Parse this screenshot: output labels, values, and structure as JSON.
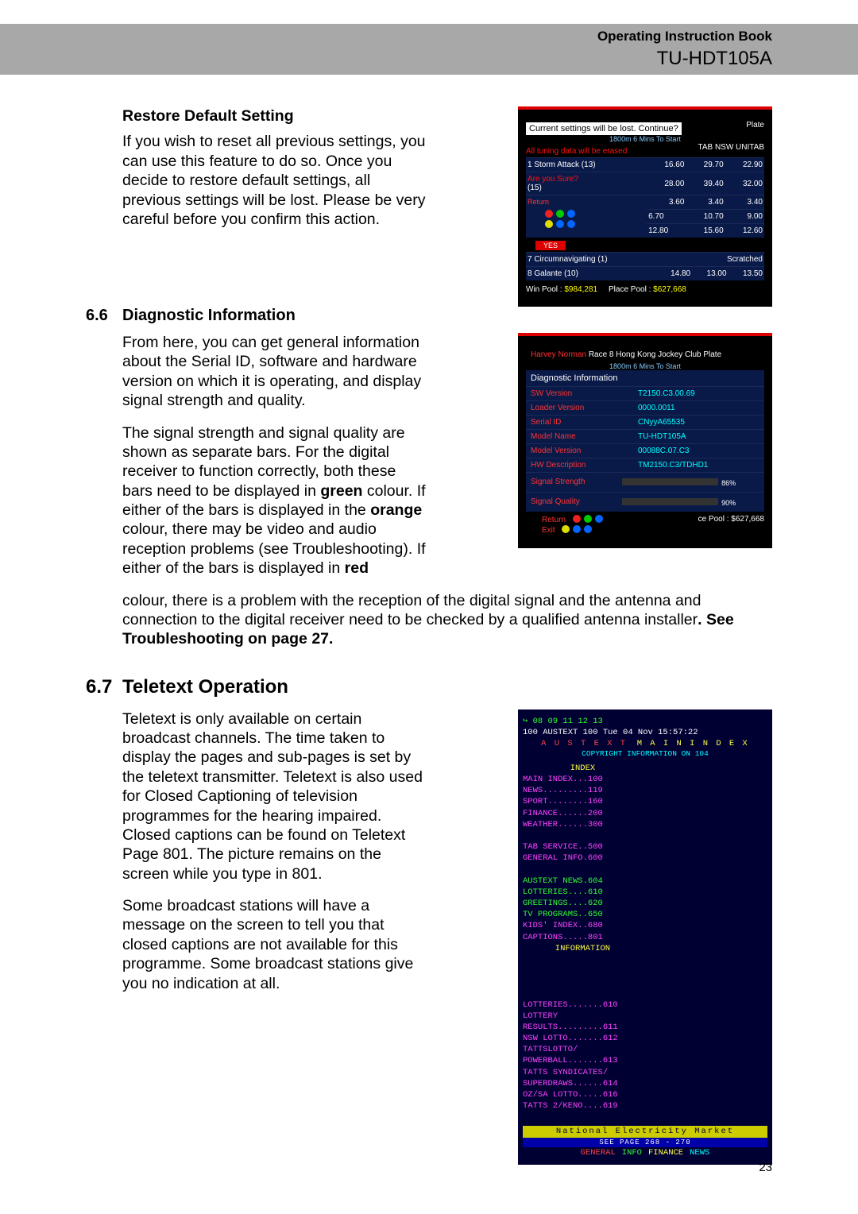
{
  "header": {
    "book_title": "Operating Instruction Book",
    "model_no": "TU-HDT105A"
  },
  "restore": {
    "title": "Restore Default Setting",
    "body": "If you wish to reset all previous settings, you can use this feature to do so. Once you decide to restore default settings, all previous settings will be lost.  Please be very careful before you confirm this action."
  },
  "sec66": {
    "num": "6.6",
    "title": "Diagnostic Information",
    "p1": "From here, you can get general information about the Serial ID, software and hardware version on which it is operating, and display signal strength and quality.",
    "p2a": "The signal strength and signal quality are shown as separate bars.  For the digital receiver to function correctly, both these bars need to be displayed in ",
    "p2_green": "green",
    "p2b": " colour. If either of the bars is displayed in the ",
    "p2_orange": "orange",
    "p2c": " colour, there may be video and audio reception problems (see Troubleshooting). If either of the bars is displayed in ",
    "p2_red": "red",
    "p2d": " colour, there is a problem with the reception of the digital signal and the antenna and connection to the digital receiver need to be checked by a qualified antenna installer",
    "p2_trail_bold": ". See Troubleshooting on page 27."
  },
  "sec67": {
    "num": "6.7",
    "title": "Teletext Operation",
    "p1": "Teletext is only available on certain broadcast channels. The time taken to display the pages and sub-pages is set by the teletext transmitter. Teletext is also used for Closed Captioning of television programmes for the hearing impaired.  Closed captions can be found on Teletext Page 801.  The picture remains on the screen while you type in 801.",
    "p2": "Some broadcast stations will have a message on the screen to tell you that closed captions are not available for this programme. Some broadcast stations give you no indication at all."
  },
  "tv1": {
    "dialog_line1": "Current settings will be lost. Continue?",
    "plate": "Plate",
    "sub1": "1800m   6 Mins To Start",
    "erase": "All tuning data will be erased",
    "col_heads": "TAB   NSW  UNITAB",
    "row1": {
      "name": "1  Storm Attack (13)",
      "a": "16.60",
      "b": "29.70",
      "c": "22.90"
    },
    "sure": "Are you Sure?",
    "row2": {
      "name": "(15)",
      "a": "28.00",
      "b": "39.40",
      "c": "32.00"
    },
    "return": "Return",
    "row3": {
      "a": "3.60",
      "b": "3.40",
      "c": "3.40"
    },
    "row4": {
      "a": "6.70",
      "b": "10.70",
      "c": "9.00"
    },
    "row5": {
      "a": "12.80",
      "b": "15.60",
      "c": "12.60"
    },
    "yes": "YES",
    "row7": {
      "name": "7  Circumnavigating (1)",
      "note": "Scratched"
    },
    "row8": {
      "name": "8  Galante (10)",
      "a": "14.80",
      "b": "13.00",
      "c": "13.50"
    },
    "win_pool_l": "Win Pool :",
    "win_pool_v": "$984,281",
    "place_pool_l": "Place Pool :",
    "place_pool_v": "$627,668"
  },
  "tv2": {
    "race_hdr": "Race 8   Hong Kong Jockey Club Plate",
    "race_sub": "1800m    6 Mins To Start",
    "title": "Diagnostic Information",
    "sw_l": "SW Version",
    "sw_v": "T2150.C3.00.69",
    "ld_l": "Loader Version",
    "ld_v": "0000.0011",
    "id_l": "Serial ID",
    "id_v": "CNyyA65535",
    "mn_l": "Model Name",
    "mn_v": "TU-HDT105A",
    "mv_l": "Model Version",
    "mv_v": "00088C.07.C3",
    "hw_l": "HW Description",
    "hw_v": "TM2150.C3/TDHD1",
    "ss_l": "Signal Strength",
    "ss_pct": "86%",
    "sq_l": "Signal Quality",
    "sq_pct": "90%",
    "return": "Return",
    "exit": "Exit",
    "place_pool": "ce Pool : $627,668"
  },
  "ttx": {
    "tabs": "08 09 11 12 13",
    "line1": "100  AUSTEXT 100 Tue 04 Nov 15:57:22",
    "hdr1": "A U S T E X T",
    "hdr2": "M A I N   I N D E X",
    "copy": "COPYRIGHT INFORMATION ON 104",
    "left_head": "INDEX",
    "right_head": "INFORMATION",
    "left": [
      "MAIN INDEX...100",
      "NEWS.........119",
      "SPORT........160",
      "FINANCE......200",
      "WEATHER......300",
      "",
      "TAB SERVICE..500",
      "GENERAL INFO.600",
      "",
      "AUSTEXT NEWS.604",
      "LOTTERIES....610",
      "GREETINGS....620",
      "TV PROGRAMS..650",
      "KIDS' INDEX..680",
      "CAPTIONS.....801"
    ],
    "right": [
      "",
      "",
      "",
      "",
      "LOTTERIES.......610",
      "LOTTERY",
      "RESULTS.........611",
      "NSW LOTTO.......612",
      "TATTSLOTTO/",
      "POWERBALL.......613",
      "TATTS SYNDICATES/",
      "SUPERDRAWS......614",
      "OZ/SA LOTTO.....616",
      "TATTS 2/KENO....619",
      ""
    ],
    "bar_y": "National Electricity Market",
    "bar_b": "SEE PAGE 268 - 270",
    "foot_g": "GENERAL",
    "foot_i": "INFO",
    "foot_f": "FINANCE",
    "foot_n": "NEWS"
  },
  "page_number": "23"
}
